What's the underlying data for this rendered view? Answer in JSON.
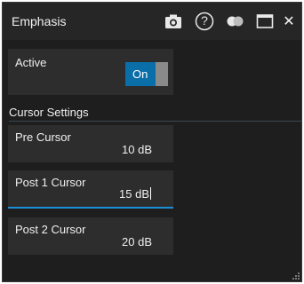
{
  "dialog": {
    "title": "Emphasis",
    "toolbar_icons": [
      "camera-icon",
      "help-icon",
      "toggle-dots-icon",
      "maximize-icon",
      "close-icon"
    ],
    "close_glyph": "✕",
    "help_glyph": "?"
  },
  "active": {
    "label": "Active",
    "toggle_text": "On"
  },
  "section": {
    "title": "Cursor Settings"
  },
  "fields": {
    "pre": {
      "label": "Pre Cursor",
      "value": "10 dB"
    },
    "post1": {
      "label": "Post 1 Cursor",
      "value": "15 dB"
    },
    "post2": {
      "label": "Post 2 Cursor",
      "value": "20 dB"
    }
  },
  "colors": {
    "accent": "#1a8fd6",
    "toggle_on": "#0a6ea8",
    "background": "#1e1e1e",
    "card": "#2d2d2d"
  }
}
